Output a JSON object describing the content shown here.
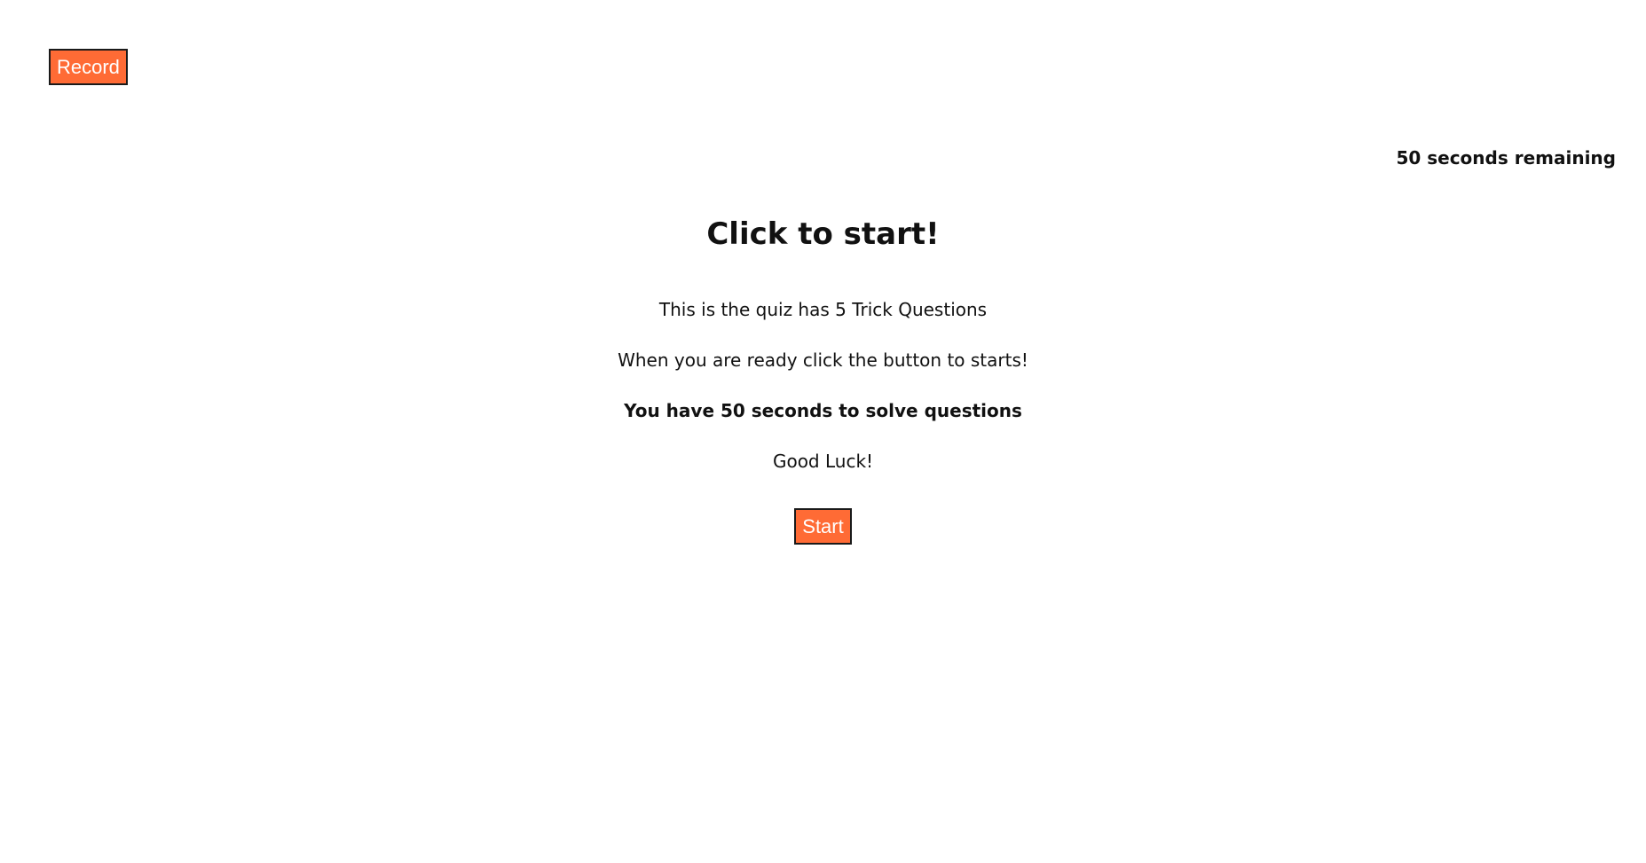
{
  "header": {
    "record_label": "Record"
  },
  "timer": {
    "text": "50 seconds remaining"
  },
  "intro": {
    "title": "Click to start!",
    "line1": "This is the quiz has 5 Trick Questions",
    "line2": "When you are ready click the button to starts!",
    "line3": "You have 50 seconds to solve questions",
    "line4": "Good Luck!",
    "start_label": "Start"
  },
  "colors": {
    "accent": "#ff6b35",
    "button_border": "#1a1a1a",
    "button_text": "#ffffff",
    "text": "#111111",
    "background": "#ffffff"
  }
}
